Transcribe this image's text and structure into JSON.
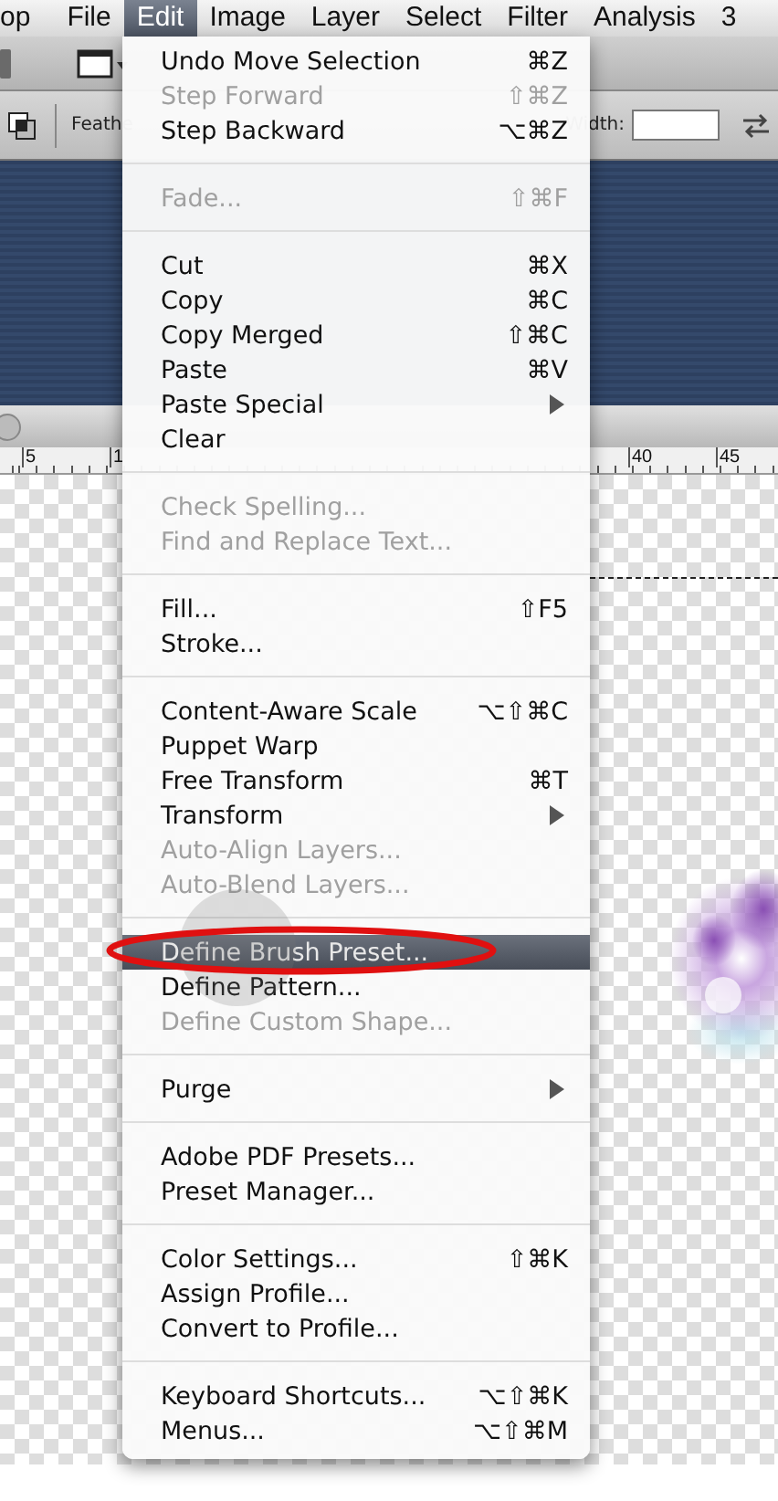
{
  "menu_bar": {
    "items": [
      {
        "label": "op",
        "selected": false
      },
      {
        "label": "File",
        "selected": false
      },
      {
        "label": "Edit",
        "selected": true
      },
      {
        "label": "Image",
        "selected": false
      },
      {
        "label": "Layer",
        "selected": false
      },
      {
        "label": "Select",
        "selected": false
      },
      {
        "label": "Filter",
        "selected": false
      },
      {
        "label": "Analysis",
        "selected": false
      },
      {
        "label": "3",
        "selected": false
      }
    ]
  },
  "options_bar": {
    "feather_label": "Feathe",
    "width_label": "Width:"
  },
  "ruler": {
    "labels": [
      "5",
      "1",
      "40",
      "45"
    ]
  },
  "edit_menu": {
    "groups": [
      [
        {
          "label": "Undo Move Selection",
          "shortcut": "⌘Z",
          "disabled": false,
          "selected": false,
          "submenu": false
        },
        {
          "label": "Step Forward",
          "shortcut": "⇧⌘Z",
          "disabled": true,
          "selected": false,
          "submenu": false
        },
        {
          "label": "Step Backward",
          "shortcut": "⌥⌘Z",
          "disabled": false,
          "selected": false,
          "submenu": false
        }
      ],
      [
        {
          "label": "Fade...",
          "shortcut": "⇧⌘F",
          "disabled": true,
          "selected": false,
          "submenu": false
        }
      ],
      [
        {
          "label": "Cut",
          "shortcut": "⌘X",
          "disabled": false,
          "selected": false,
          "submenu": false
        },
        {
          "label": "Copy",
          "shortcut": "⌘C",
          "disabled": false,
          "selected": false,
          "submenu": false
        },
        {
          "label": "Copy Merged",
          "shortcut": "⇧⌘C",
          "disabled": false,
          "selected": false,
          "submenu": false
        },
        {
          "label": "Paste",
          "shortcut": "⌘V",
          "disabled": false,
          "selected": false,
          "submenu": false
        },
        {
          "label": "Paste Special",
          "disabled": false,
          "selected": false,
          "submenu": true
        },
        {
          "label": "Clear",
          "disabled": false,
          "selected": false,
          "submenu": false
        }
      ],
      [
        {
          "label": "Check Spelling...",
          "disabled": true,
          "selected": false,
          "submenu": false
        },
        {
          "label": "Find and Replace Text...",
          "disabled": true,
          "selected": false,
          "submenu": false
        }
      ],
      [
        {
          "label": "Fill...",
          "shortcut": "⇧F5",
          "disabled": false,
          "selected": false,
          "submenu": false
        },
        {
          "label": "Stroke...",
          "disabled": false,
          "selected": false,
          "submenu": false
        }
      ],
      [
        {
          "label": "Content-Aware Scale",
          "shortcut": "⌥⇧⌘C",
          "disabled": false,
          "selected": false,
          "submenu": false
        },
        {
          "label": "Puppet Warp",
          "disabled": false,
          "selected": false,
          "submenu": false
        },
        {
          "label": "Free Transform",
          "shortcut": "⌘T",
          "disabled": false,
          "selected": false,
          "submenu": false
        },
        {
          "label": "Transform",
          "disabled": false,
          "selected": false,
          "submenu": true
        },
        {
          "label": "Auto-Align Layers...",
          "disabled": true,
          "selected": false,
          "submenu": false
        },
        {
          "label": "Auto-Blend Layers...",
          "disabled": true,
          "selected": false,
          "submenu": false
        }
      ],
      [
        {
          "label": "Define Brush Preset...",
          "disabled": false,
          "selected": true,
          "submenu": false
        },
        {
          "label": "Define Pattern...",
          "disabled": false,
          "selected": false,
          "submenu": false
        },
        {
          "label": "Define Custom Shape...",
          "disabled": true,
          "selected": false,
          "submenu": false
        }
      ],
      [
        {
          "label": "Purge",
          "disabled": false,
          "selected": false,
          "submenu": true
        }
      ],
      [
        {
          "label": "Adobe PDF Presets...",
          "disabled": false,
          "selected": false,
          "submenu": false
        },
        {
          "label": "Preset Manager...",
          "disabled": false,
          "selected": false,
          "submenu": false
        }
      ],
      [
        {
          "label": "Color Settings...",
          "shortcut": "⇧⌘K",
          "disabled": false,
          "selected": false,
          "submenu": false
        },
        {
          "label": "Assign Profile...",
          "disabled": false,
          "selected": false,
          "submenu": false
        },
        {
          "label": "Convert to Profile...",
          "disabled": false,
          "selected": false,
          "submenu": false
        }
      ],
      [
        {
          "label": "Keyboard Shortcuts...",
          "shortcut": "⌥⇧⌘K",
          "disabled": false,
          "selected": false,
          "submenu": false
        },
        {
          "label": "Menus...",
          "shortcut": "⌥⇧⌘M",
          "disabled": false,
          "selected": false,
          "submenu": false
        }
      ]
    ]
  }
}
